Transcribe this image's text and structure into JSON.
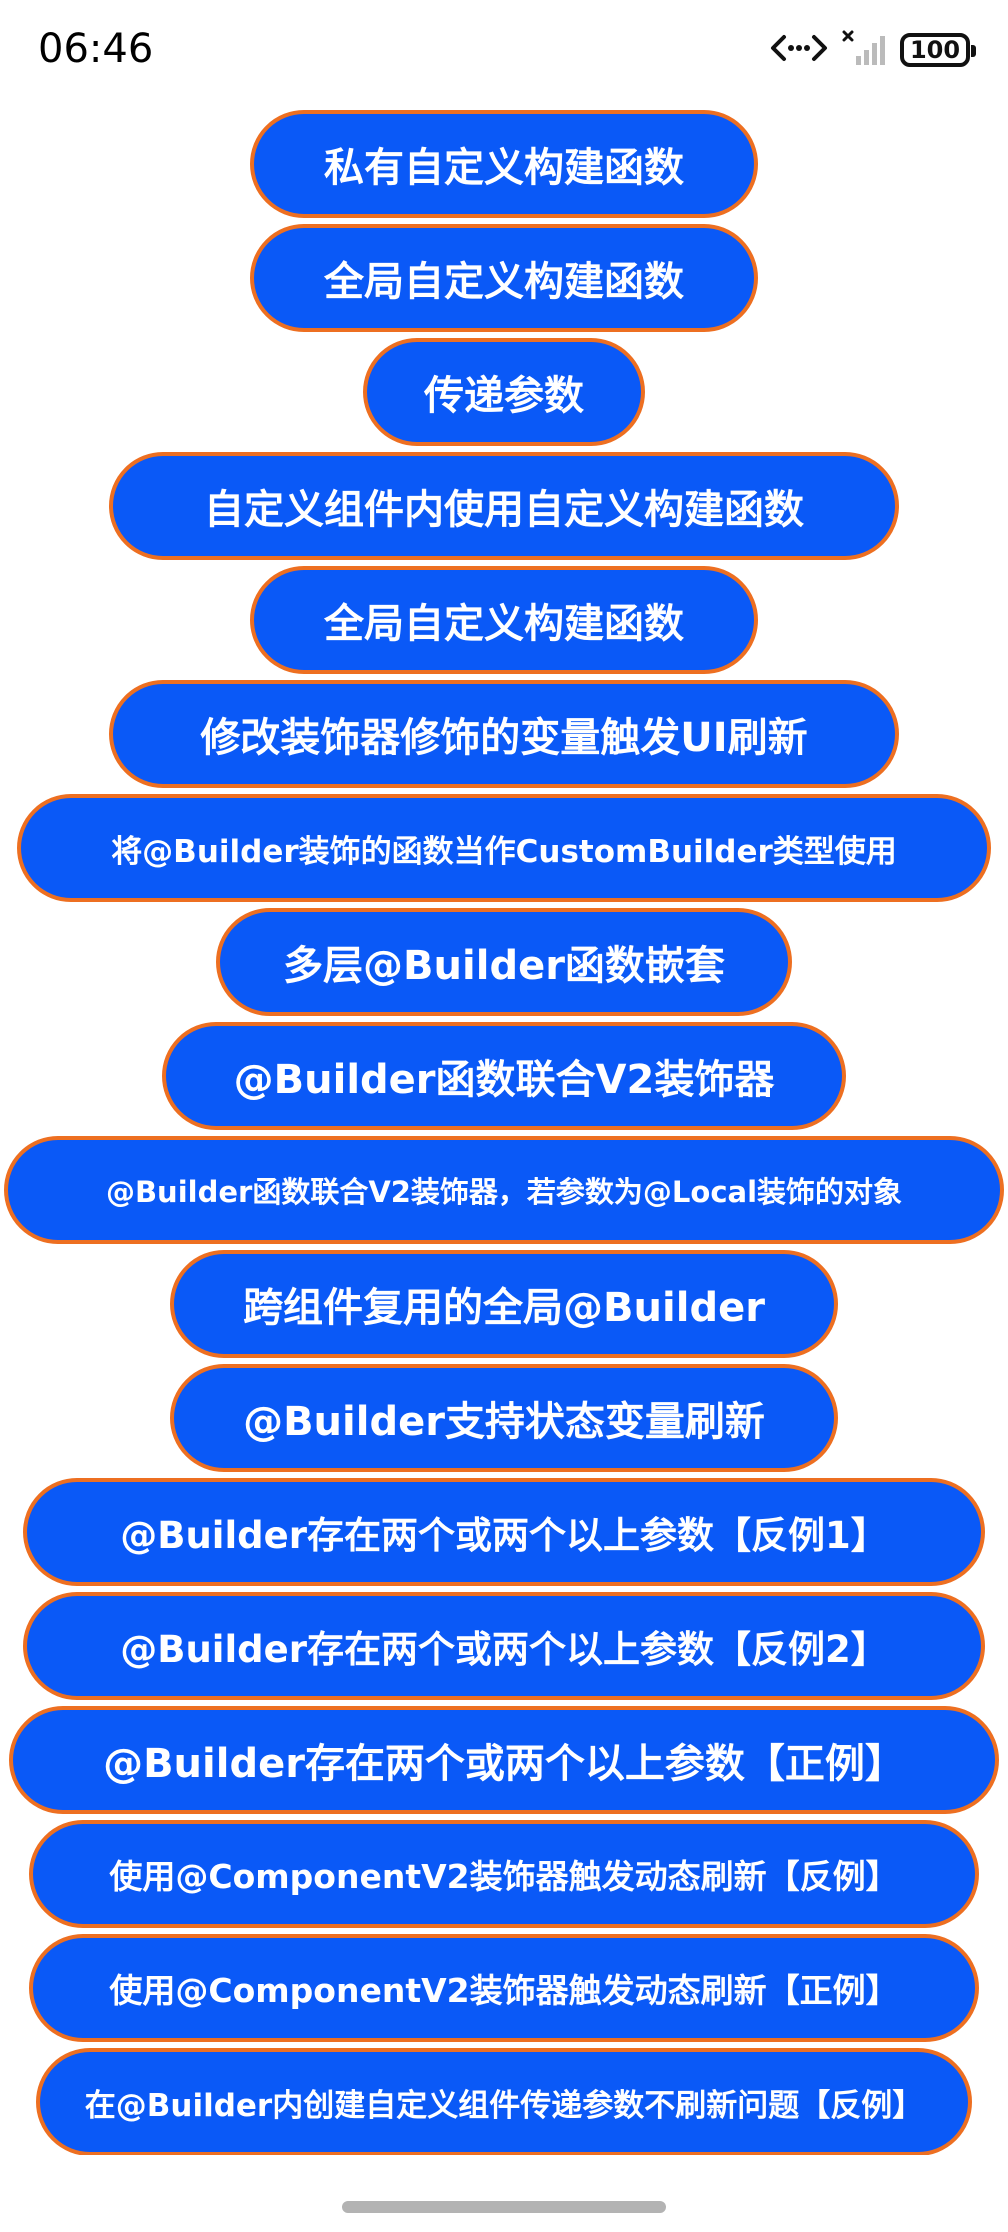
{
  "status_bar": {
    "time": "06:46",
    "battery": "100",
    "icons": [
      "data-transfer-icon",
      "signal-icon",
      "battery-icon"
    ]
  },
  "theme": {
    "button_bg": "#0a59f7",
    "button_border": "#ed6f21",
    "button_text": "#ffffff"
  },
  "buttons": [
    "私有自定义构建函数",
    "全局自定义构建函数",
    "传递参数",
    "自定义组件内使用自定义构建函数",
    "全局自定义构建函数",
    "修改装饰器修饰的变量触发UI刷新",
    "将@Builder装饰的函数当作CustomBuilder类型使用",
    "多层@Builder函数嵌套",
    "@Builder函数联合V2装饰器",
    "@Builder函数联合V2装饰器，若参数为@Local装饰的对象",
    "跨组件复用的全局@Builder",
    "@Builder支持状态变量刷新",
    "@Builder存在两个或两个以上参数【反例1】",
    "@Builder存在两个或两个以上参数【反例2】",
    "@Builder存在两个或两个以上参数【正例】",
    "使用@ComponentV2装饰器触发动态刷新【反例】",
    "使用@ComponentV2装饰器触发动态刷新【正例】",
    "在@Builder内创建自定义组件传递参数不刷新问题【反例】"
  ]
}
